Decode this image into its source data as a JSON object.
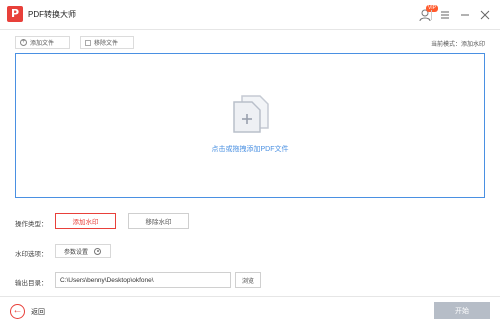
{
  "window": {
    "title": "PDF转换大师",
    "logo_letter": "P",
    "vip_badge": "VIP"
  },
  "toolbar": {
    "add_file_label": "添加文件",
    "remove_file_label": "移除文件",
    "mode_text": "当前模式：添加水印"
  },
  "drop_area": {
    "hint": "点击或拖拽添加PDF文件"
  },
  "form": {
    "operation_label": "操作类型：",
    "add_watermark_label": "添加水印",
    "remove_watermark_label": "移除水印",
    "watermark_options_label": "水印选项：",
    "param_settings_label": "参数设置",
    "output_dir_label": "输出目录：",
    "output_path": "C:\\Users\\benny\\Desktop\\okfone\\",
    "browse_label": "浏览"
  },
  "bottom": {
    "back_label": "返回",
    "start_label": "开始"
  },
  "colors": {
    "accent": "#e8403a",
    "drop_border": "#4a90e2",
    "start_disabled": "#b6bdc7"
  },
  "icons": {
    "logo": "app-logo-icon",
    "user": "user-icon",
    "menu": "menu-icon",
    "minimize": "minimize-icon",
    "close": "close-icon",
    "add": "add-circle-icon",
    "remove": "remove-file-icon",
    "drop": "add-document-icon",
    "gear": "gear-icon",
    "back": "back-arrow-icon"
  }
}
